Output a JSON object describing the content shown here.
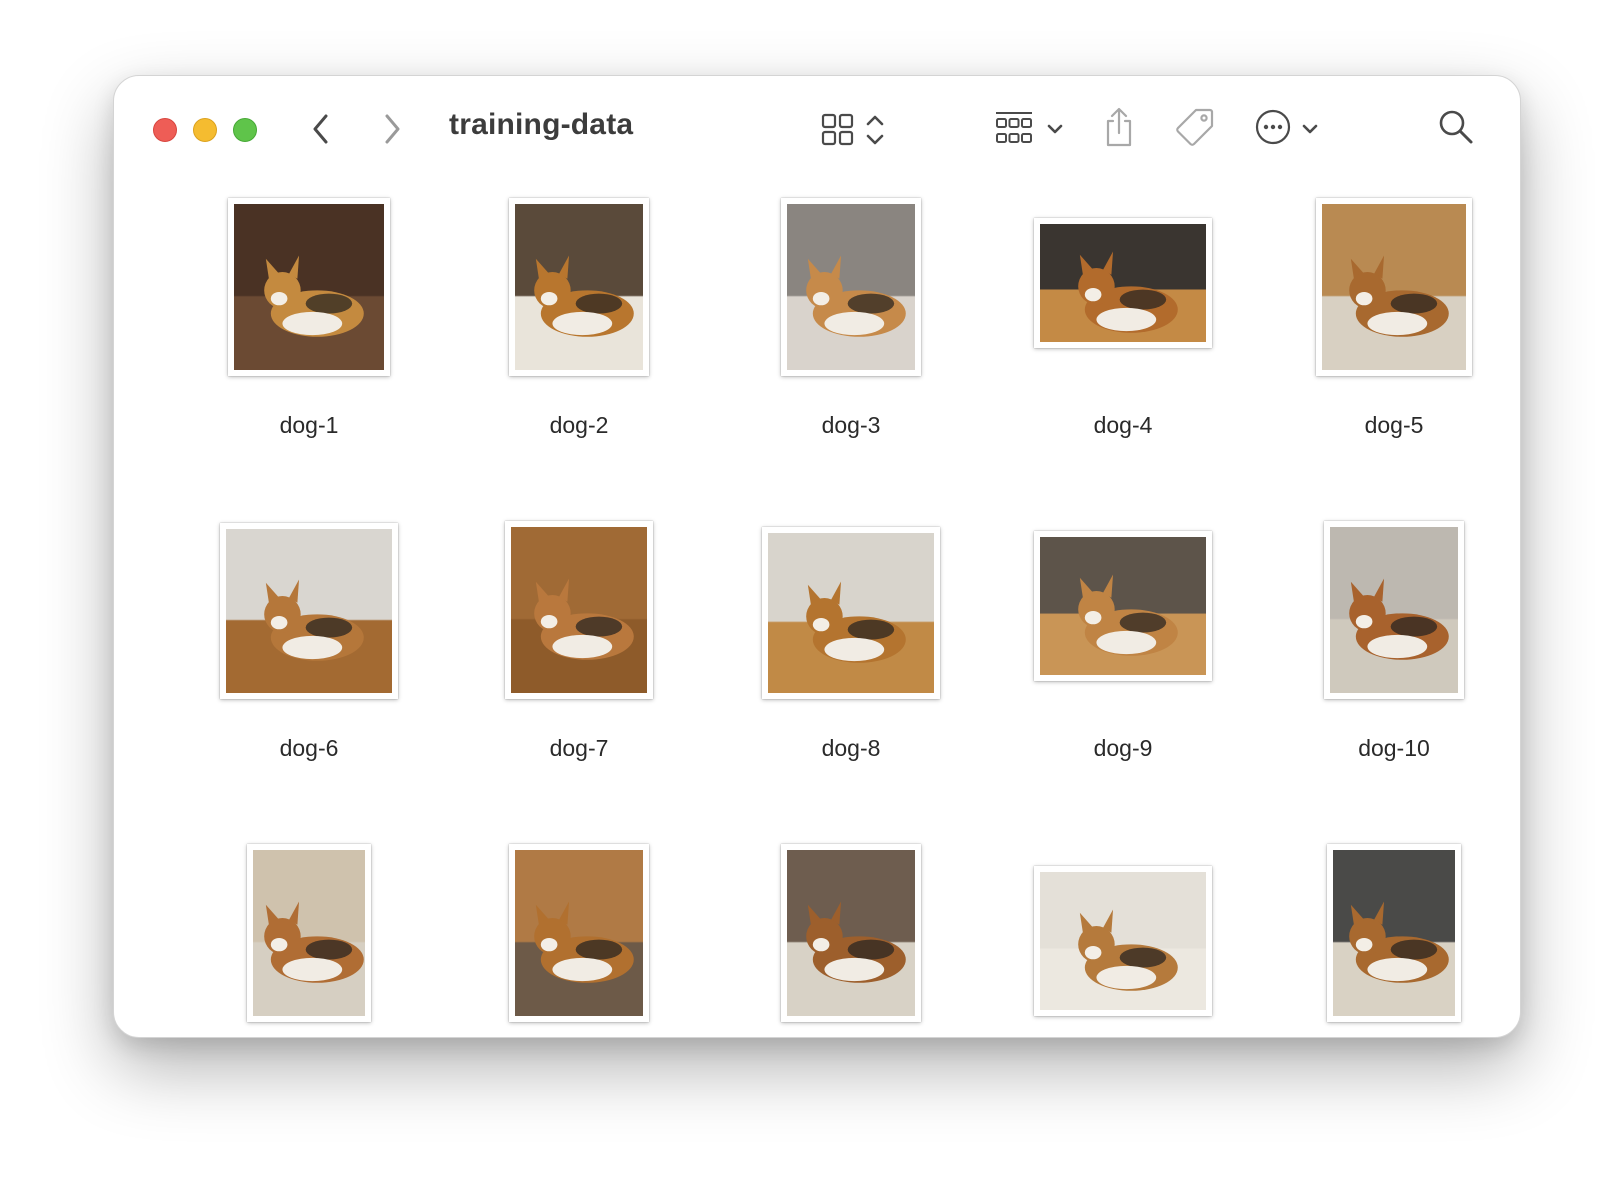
{
  "window": {
    "title": "training-data"
  },
  "toolbar": {
    "icons": [
      "close-button",
      "minimize-button",
      "zoom-button",
      "back-chevron-icon",
      "forward-chevron-icon",
      "icon-view-grid-icon",
      "up-down-chevron-icon",
      "group-by-icon",
      "chevron-down-icon",
      "share-icon",
      "tag-icon",
      "more-ellipsis-icon",
      "chevron-down-icon",
      "search-icon"
    ]
  },
  "files": [
    {
      "name": "dog-1",
      "bg": "#4a3224",
      "accent": "#c48a3f",
      "floor": "#6b4a33"
    },
    {
      "name": "dog-2",
      "bg": "#5a4a3a",
      "accent": "#b8762e",
      "floor": "#e9e4da"
    },
    {
      "name": "dog-3",
      "bg": "#8a8580",
      "accent": "#c68a4a",
      "floor": "#d9d3cc"
    },
    {
      "name": "dog-4",
      "bg": "#3a3530",
      "accent": "#b26b2c",
      "floor": "#c48a45"
    },
    {
      "name": "dog-5",
      "bg": "#b98a52",
      "accent": "#a8692f",
      "floor": "#d8d0c2"
    },
    {
      "name": "dog-6",
      "bg": "#d9d6d0",
      "accent": "#b5773a",
      "floor": "#a36a32"
    },
    {
      "name": "dog-7",
      "bg": "#a06a35",
      "accent": "#b9783d",
      "floor": "#8e5b2a"
    },
    {
      "name": "dog-8",
      "bg": "#d8d4cc",
      "accent": "#b4742f",
      "floor": "#c18a46"
    },
    {
      "name": "dog-9",
      "bg": "#5d544a",
      "accent": "#c08444",
      "floor": "#c99556"
    },
    {
      "name": "dog-10",
      "bg": "#bdb8b0",
      "accent": "#a8622d",
      "floor": "#cfc9bd"
    },
    {
      "name": "",
      "bg": "#cfc2ad",
      "accent": "#b06d34",
      "floor": "#d6cfc2"
    },
    {
      "name": "",
      "bg": "#b07a45",
      "accent": "#b1702f",
      "floor": "#6d5a48"
    },
    {
      "name": "",
      "bg": "#6e5d4f",
      "accent": "#9d5f2c",
      "floor": "#d8d2c6"
    },
    {
      "name": "",
      "bg": "#e4e0d8",
      "accent": "#b57a3c",
      "floor": "#ece8e0"
    },
    {
      "name": "",
      "bg": "#4a4a48",
      "accent": "#a8692f",
      "floor": "#d9d2c4"
    }
  ]
}
